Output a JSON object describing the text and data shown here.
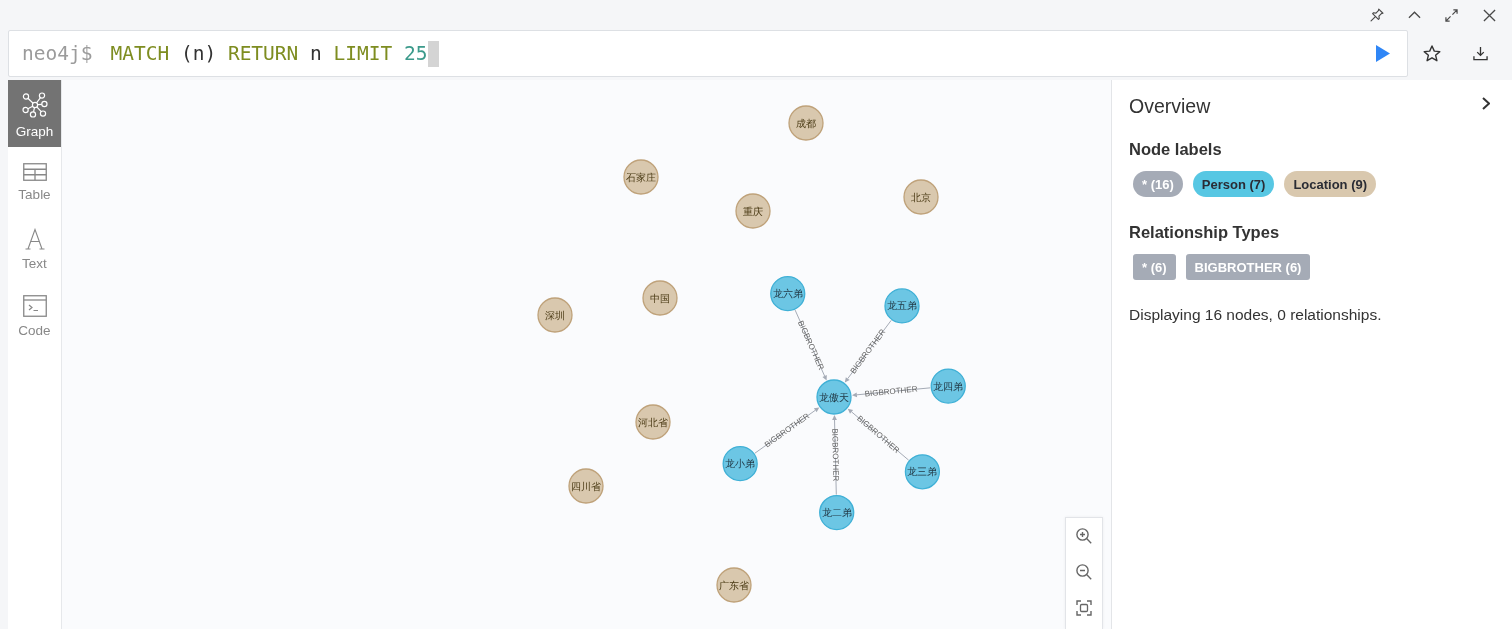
{
  "editor": {
    "prompt": "neo4j$",
    "query": [
      {
        "text": "MATCH",
        "kind": "keyword"
      },
      {
        "text": "(n)",
        "kind": "plain"
      },
      {
        "text": "RETURN",
        "kind": "keyword"
      },
      {
        "text": "n",
        "kind": "plain"
      },
      {
        "text": "LIMIT",
        "kind": "keyword"
      },
      {
        "text": "25",
        "kind": "number"
      }
    ]
  },
  "sidebar": {
    "items": [
      {
        "label": "Graph",
        "kind": "graph",
        "selected": true
      },
      {
        "label": "Table",
        "kind": "table",
        "selected": false
      },
      {
        "label": "Text",
        "kind": "text",
        "selected": false
      },
      {
        "label": "Code",
        "kind": "code",
        "selected": false
      }
    ]
  },
  "graph": {
    "nodes": [
      {
        "label": "成都",
        "kind": "location"
      },
      {
        "label": "石家庄",
        "kind": "location"
      },
      {
        "label": "北京",
        "kind": "location"
      },
      {
        "label": "重庆",
        "kind": "location"
      },
      {
        "label": "中国",
        "kind": "location"
      },
      {
        "label": "深圳",
        "kind": "location"
      },
      {
        "label": "龙傲天",
        "kind": "person",
        "incoming": [
          {
            "type": "BIGBROTHER",
            "from": {
              "label": "龙六弟",
              "kind": "person"
            }
          },
          {
            "type": "BIGBROTHER",
            "from": {
              "label": "龙五弟",
              "kind": "person"
            }
          },
          {
            "type": "BIGBROTHER",
            "from": {
              "label": "龙四弟",
              "kind": "person"
            }
          },
          {
            "type": "BIGBROTHER",
            "from": {
              "label": "龙三弟",
              "kind": "person"
            }
          },
          {
            "type": "BIGBROTHER",
            "from": {
              "label": "龙二弟",
              "kind": "person"
            }
          },
          {
            "type": "BIGBROTHER",
            "from": {
              "label": "龙小弟",
              "kind": "person"
            }
          }
        ]
      },
      {
        "label": "河北省",
        "kind": "location"
      },
      {
        "label": "四川省",
        "kind": "location"
      },
      {
        "label": "广东省",
        "kind": "location"
      }
    ]
  },
  "overview": {
    "title": "Overview",
    "node_labels": {
      "heading": "Node labels",
      "chips": [
        {
          "label": "* (16)",
          "kind": "all",
          "color": "#a5abb6"
        },
        {
          "label": "Person (7)",
          "kind": "label",
          "color": "#57c7e3"
        },
        {
          "label": "Location (9)",
          "kind": "label",
          "color": "#d9c8ae"
        }
      ]
    },
    "relationship_types": {
      "heading": "Relationship Types",
      "chips": [
        {
          "label": "* (6)"
        },
        {
          "label": "BIGBROTHER (6)"
        }
      ]
    },
    "summary": "Displaying 16 nodes, 0 relationships."
  }
}
